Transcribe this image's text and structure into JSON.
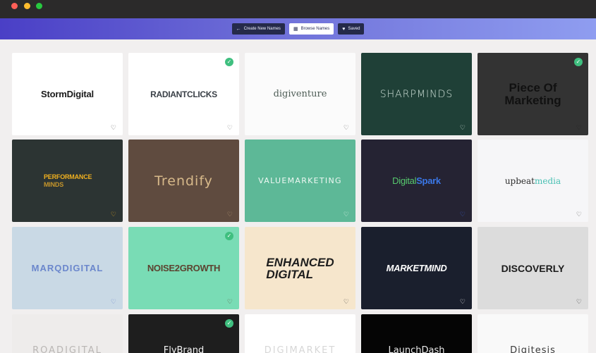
{
  "window": {
    "controls": [
      "close",
      "minimize",
      "zoom"
    ]
  },
  "nav": {
    "create": {
      "icon": "back-arrow-icon",
      "label": "Create New Names"
    },
    "browse": {
      "icon": "grid-icon",
      "label": "Browse Names"
    },
    "saved": {
      "icon": "heart-icon",
      "label": "Saved"
    }
  },
  "tiles": [
    {
      "name": "StormDigital",
      "background": "#ffffff",
      "checked": false
    },
    {
      "name": "RADIANTCLICKS",
      "background": "#ffffff",
      "checked": true
    },
    {
      "name": "digiventure",
      "background": "#fbfbfb",
      "checked": false
    },
    {
      "name": "SHARPMINDS",
      "background": "#1f4037",
      "checked": false
    },
    {
      "name_line1": "Piece Of",
      "name_line2": "Marketing",
      "background": "#333333",
      "checked": true
    },
    {
      "name_line1": "PERFORMANCE",
      "name_line2": "MINDS",
      "background": "#2c3433",
      "checked": false
    },
    {
      "name": "Trendify",
      "background": "#5f4b3f",
      "checked": false
    },
    {
      "name": "VALUEMARKETING",
      "background": "#5db897",
      "checked": false
    },
    {
      "name_a": "Digital",
      "name_b": "Spark",
      "background": "#252333",
      "checked": false
    },
    {
      "name_a": "upbeat",
      "name_b": "media",
      "background": "#f6f6f8",
      "checked": false
    },
    {
      "name": "MARQDIGITAL",
      "background": "#c9d9e5",
      "checked": false
    },
    {
      "name": "NOISE2GROWTH",
      "background": "#79dcb5",
      "checked": true
    },
    {
      "name_line1": "ENHANCED",
      "name_line2": "DIGITAL",
      "background": "#f6e6cc",
      "checked": false
    },
    {
      "name": "MARKETMIND",
      "background": "#1a1f2d",
      "checked": false
    },
    {
      "name": "DISCOVERLY",
      "background": "#dcdcdc",
      "checked": false
    },
    {
      "name": "ROADIGITAL",
      "background": "#eeeceb",
      "checked": false
    },
    {
      "name": "FlyBrand",
      "background": "#1e1e1e",
      "checked": true
    },
    {
      "name": "DIGIMARKET",
      "background": "#ffffff",
      "checked": false
    },
    {
      "name": "LaunchDash",
      "background": "#050505",
      "checked": false
    },
    {
      "name": "Digitesis",
      "background": "#f9f9f9",
      "checked": false
    }
  ],
  "icons": {
    "favorite": "heart-outline-icon",
    "selected": "check-circle-icon"
  },
  "colors": {
    "accent_check": "#3fbf7f",
    "nav_gradient_start": "#4a3fc6",
    "nav_gradient_end": "#8f9df0"
  }
}
